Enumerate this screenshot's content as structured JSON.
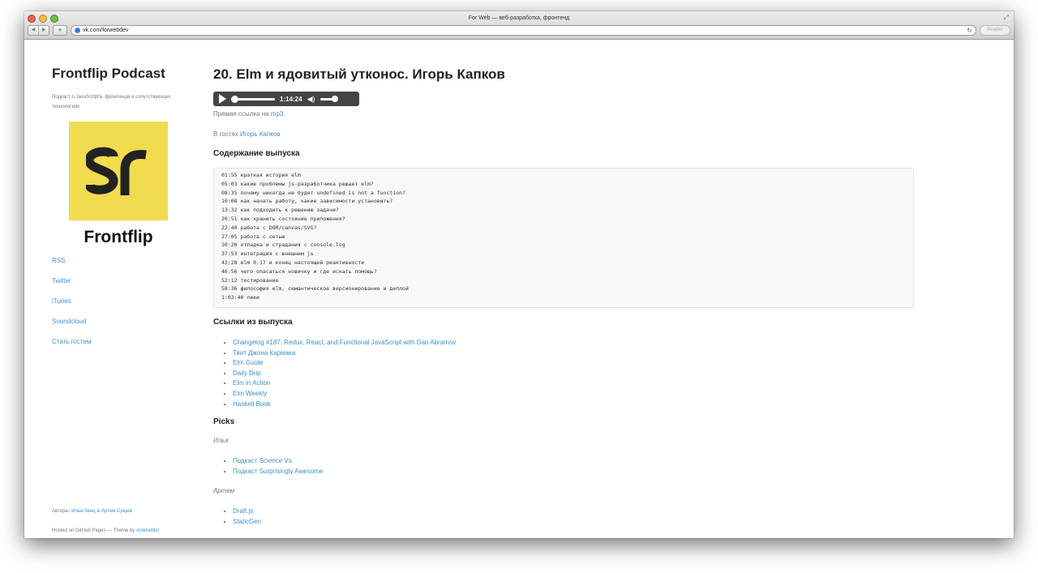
{
  "window": {
    "title": "For Web — веб-разработка, фронтенд",
    "url": "vk.com/forwebdev",
    "reader_label": "Reader"
  },
  "sidebar": {
    "title": "Frontflip Podcast",
    "description": "Подкаст о JavaScript'е, фронтенде и сопутствующих технологиях",
    "logo_text": "Frontflip",
    "logo_color": "#f0dc4e",
    "nav": [
      "RSS",
      "Twitter",
      "iTunes",
      "Soundcloud",
      "Стать гостем"
    ],
    "authors_label": "Авторы:",
    "authors": "Илья Зеиц & Артем Сущев",
    "hosted_text": "Hosted on GitHub Pages — Theme by",
    "theme_author": "orderedlist"
  },
  "episode": {
    "title": "20. Elm и ядовитый утконос. Игорь Капков",
    "player": {
      "time": "1:14:24",
      "progress": 0
    },
    "direct_link_text": "Прямая ссылка на",
    "direct_link": "mp3",
    "direct_link_suffix": ".",
    "guest_label": "В гостях",
    "guest": "Игорь Капков",
    "contents_heading": "Содержание выпуска",
    "timecodes": [
      "01:55 краткая история elm",
      "05:03 какие проблемы js-разработчика решает elm?",
      "08:35 почему никогда не будет undefined is not a function?",
      "10:08 как начать работу, какие зависимости установить?",
      "13:32 как подходить к решению задачи?",
      "20:51 как хранить состояние приложения?",
      "22:40 работа с DOM/canvas/SVG?",
      "27:05 работа с сетью",
      "30:20 отладка и страдания с console.log",
      "37:53 интеграция с внешним js",
      "43:28 elm 0.17 и конец настоящей реактивности",
      "46:56 чего опасаться новичку и где искать помощь?",
      "52:12 тестирование",
      "58:36 философия elm, семантическое версионирование и деплой",
      "1:02:40 пики"
    ],
    "links_heading": "Ссылки из выпуска",
    "links": [
      "Changelog #187: Redux, React, and Functional JavaScript with Dan Abramov",
      "Твит Джона Кармака",
      "Elm Guide",
      "Daily Drip",
      "Elm in Action",
      "Elm Weekly",
      "Haskell Book"
    ],
    "picks_heading": "Picks",
    "picks": [
      {
        "name": "Илья",
        "items": [
          "Подкаст Science Vs.",
          "Подкаст Surprisingly Awesome"
        ]
      },
      {
        "name": "Артем",
        "items": [
          "Draft.js",
          "StaticGen"
        ]
      }
    ]
  }
}
